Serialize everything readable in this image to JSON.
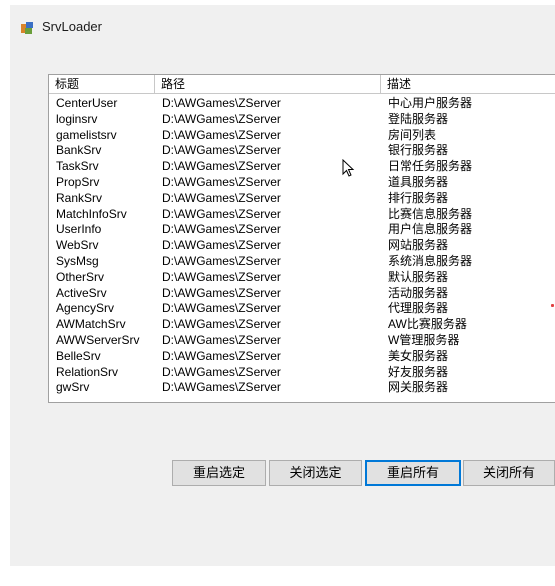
{
  "window": {
    "title": "SrvLoader"
  },
  "listview": {
    "columns": [
      "标题",
      "路径",
      "描述"
    ],
    "rows": [
      [
        "CenterUser",
        "D:\\AWGames\\ZServer",
        "中心用户服务器"
      ],
      [
        "loginsrv",
        "D:\\AWGames\\ZServer",
        "登陆服务器"
      ],
      [
        "gamelistsrv",
        "D:\\AWGames\\ZServer",
        "房间列表"
      ],
      [
        "BankSrv",
        "D:\\AWGames\\ZServer",
        "银行服务器"
      ],
      [
        "TaskSrv",
        "D:\\AWGames\\ZServer",
        "日常任务服务器"
      ],
      [
        "PropSrv",
        "D:\\AWGames\\ZServer",
        "道具服务器"
      ],
      [
        "RankSrv",
        "D:\\AWGames\\ZServer",
        "排行服务器"
      ],
      [
        "MatchInfoSrv",
        "D:\\AWGames\\ZServer",
        "比赛信息服务器"
      ],
      [
        "UserInfo",
        "D:\\AWGames\\ZServer",
        "用户信息服务器"
      ],
      [
        "WebSrv",
        "D:\\AWGames\\ZServer",
        "网站服务器"
      ],
      [
        "SysMsg",
        "D:\\AWGames\\ZServer",
        "系统消息服务器"
      ],
      [
        "OtherSrv",
        "D:\\AWGames\\ZServer",
        "默认服务器"
      ],
      [
        "ActiveSrv",
        "D:\\AWGames\\ZServer",
        "活动服务器"
      ],
      [
        "AgencySrv",
        "D:\\AWGames\\ZServer",
        "代理服务器"
      ],
      [
        "AWMatchSrv",
        "D:\\AWGames\\ZServer",
        "AW比赛服务器"
      ],
      [
        "AWWServerSrv",
        "D:\\AWGames\\ZServer",
        "W管理服务器"
      ],
      [
        "BelleSrv",
        "D:\\AWGames\\ZServer",
        "美女服务器"
      ],
      [
        "RelationSrv",
        "D:\\AWGames\\ZServer",
        "好友服务器"
      ],
      [
        "gwSrv",
        "D:\\AWGames\\ZServer",
        "网关服务器"
      ]
    ]
  },
  "buttons": {
    "restart_selected": "重启选定",
    "close_selected": "关闭选定",
    "restart_all": "重启所有",
    "close_all": "关闭所有"
  },
  "colors": {
    "window_bg": "#f0f0f0",
    "button_bg": "#e1e1e1",
    "focus_border": "#0078d7"
  },
  "icons": {
    "app": "app-icon",
    "cursor": "mouse-pointer-icon"
  }
}
